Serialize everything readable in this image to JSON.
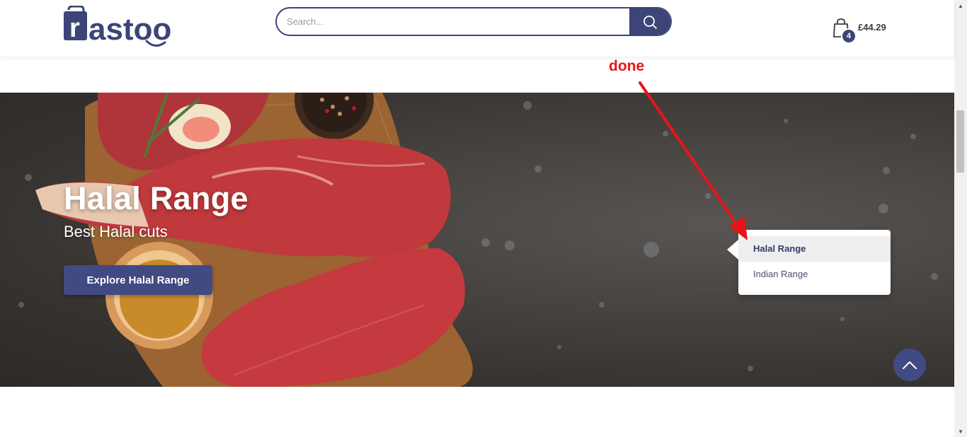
{
  "header": {
    "logo_text": "rastoo",
    "search": {
      "placeholder": "Search..."
    },
    "cart": {
      "count": "4",
      "total": "£44.29"
    }
  },
  "annotation": {
    "text": "done"
  },
  "hero": {
    "title": "Halal Range",
    "subtitle": "Best Halal cuts",
    "button_label": "Explore Halal Range"
  },
  "menu": {
    "items": [
      {
        "label": "Halal Range",
        "active": true
      },
      {
        "label": "Indian Range",
        "active": false
      }
    ]
  },
  "colors": {
    "brand": "#3c4478",
    "annotation": "#e8141a"
  },
  "icons": [
    "search-icon",
    "shopping-bag-icon",
    "chevron-up-icon"
  ]
}
